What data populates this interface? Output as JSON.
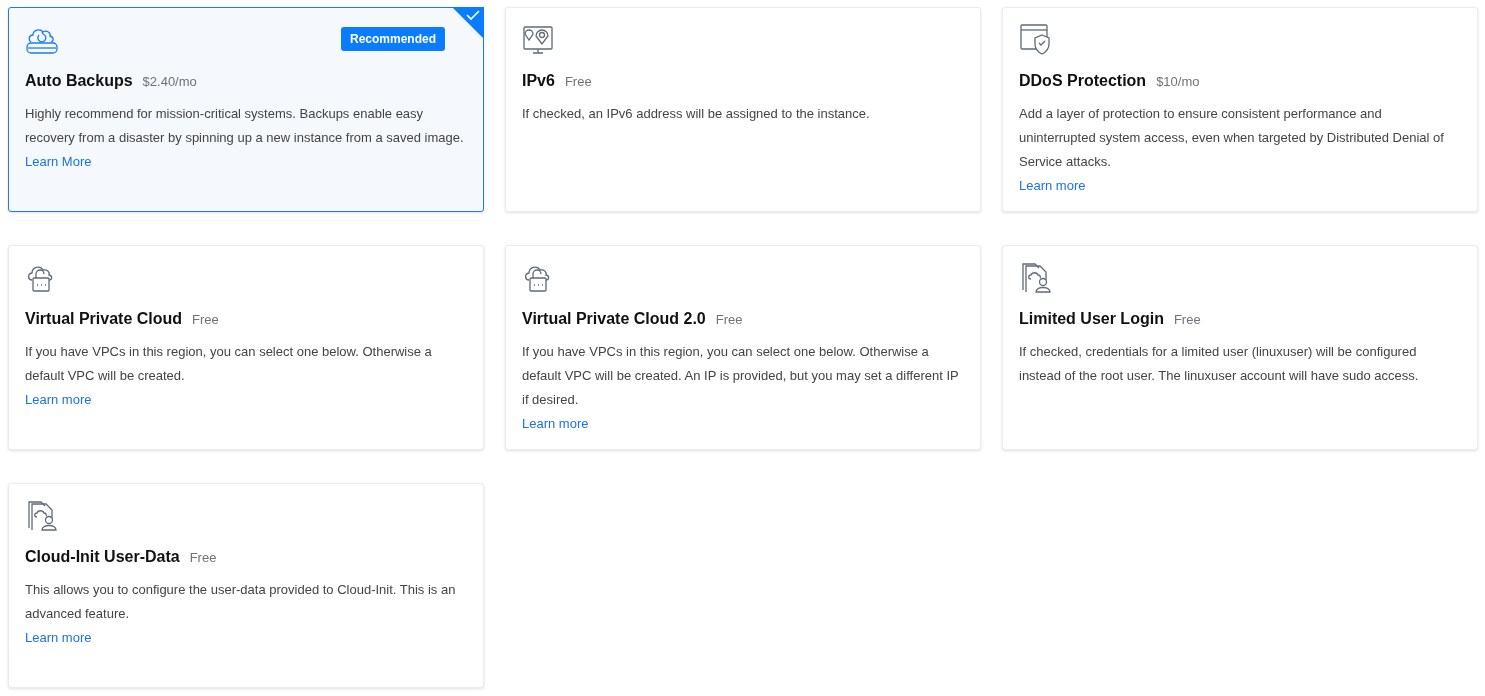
{
  "cards": [
    {
      "kind": "backup",
      "title": "Auto Backups",
      "price": "$2.40/mo",
      "badge": "Recommended",
      "selected": true,
      "description": "Highly recommend for mission-critical systems. Backups enable easy recovery from a disaster by spinning up a new instance from a saved image.",
      "link": "Learn More"
    },
    {
      "kind": "pins",
      "title": "IPv6",
      "price": "Free",
      "selected": false,
      "description": "If checked, an IPv6 address will be assigned to the instance."
    },
    {
      "kind": "shield",
      "title": "DDoS Protection",
      "price": "$10/mo",
      "selected": false,
      "description": "Add a layer of protection to ensure consistent performance and uninterrupted system access, even when targeted by Distributed Denial of Service attacks.",
      "link": "Learn more"
    },
    {
      "kind": "cloudlock",
      "title": "Virtual Private Cloud",
      "price": "Free",
      "selected": false,
      "description": "If you have VPCs in this region, you can select one below. Otherwise a default VPC will be created.",
      "link": "Learn more"
    },
    {
      "kind": "cloudlock",
      "title": "Virtual Private Cloud 2.0",
      "price": "Free",
      "selected": false,
      "description": "If you have VPCs in this region, you can select one below. Otherwise a default VPC will be created. An IP is provided, but you may set a different IP if desired.",
      "link": "Learn more"
    },
    {
      "kind": "userdoc",
      "title": "Limited User Login",
      "price": "Free",
      "selected": false,
      "description": "If checked, credentials for a limited user (linuxuser) will be configured instead of the root user. The linuxuser account will have sudo access."
    },
    {
      "kind": "userdoc",
      "title": "Cloud-Init User-Data",
      "price": "Free",
      "selected": false,
      "description": "This allows you to configure the user-data provided to Cloud-Init. This is an advanced feature.",
      "link": "Learn more"
    }
  ]
}
